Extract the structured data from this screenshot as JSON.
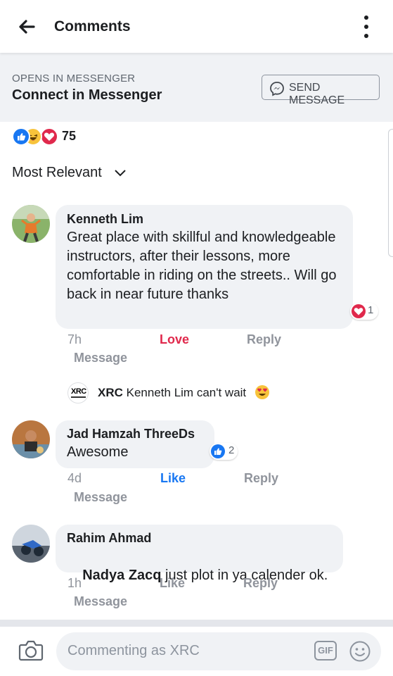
{
  "header": {
    "title": "Comments"
  },
  "messenger": {
    "opens_label": "OPENS IN MESSENGER",
    "connect_label": "Connect in Messenger",
    "send_button": "SEND MESSAGE"
  },
  "reactions_summary": {
    "count": "75",
    "types": [
      "like-icon",
      "haha-icon",
      "love-icon"
    ]
  },
  "sort": {
    "label": "Most Relevant"
  },
  "comments": [
    {
      "author": "Kenneth Lim",
      "text": "Great place with skillful and knowledgeable instructors, after  their lessons, more comfortable in riding on the streets.. Will go back in near future thanks",
      "time": "7h",
      "reaction_action": "Love",
      "reply": "Reply",
      "message": "Message",
      "reaction_count": "1"
    },
    {
      "author": "Jad Hamzah ThreeDs",
      "text": "Awesome",
      "time": "4d",
      "reaction_action": "Like",
      "reply": "Reply",
      "message": "Message",
      "reaction_count": "2"
    },
    {
      "author": "Rahim Ahmad",
      "mention": "Nadya Zacq",
      "text": " just plot in ya calender ok.",
      "time": "1h",
      "reaction_action": "Like",
      "reply": "Reply",
      "message": "Message"
    }
  ],
  "page_reply": {
    "author": "XRC",
    "logo_text": "XRC",
    "text": "Kenneth Lim can't wait"
  },
  "composer": {
    "placeholder": "Commenting as XRC",
    "gif_label": "GIF"
  },
  "colors": {
    "like_blue": "#1877f2",
    "love_red": "#e0294c",
    "bubble_bg": "#f0f2f5"
  }
}
